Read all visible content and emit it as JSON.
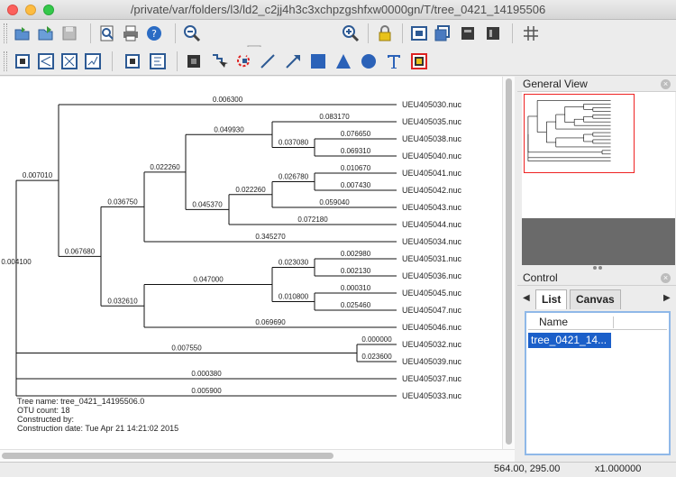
{
  "window": {
    "title": "/private/var/folders/l3/ld2_c2jj4h3c3xchpzgshfxw0000gn/T/tree_0421_14195506"
  },
  "toolbar": {
    "row1_icons": [
      "open-icon",
      "open-as-icon",
      "save-icon",
      "find-icon",
      "print-icon",
      "help-icon",
      "zoom-out-icon",
      "zoom-in-icon",
      "lock-icon",
      "fit-window-icon",
      "fit-page-icon",
      "layout-a-icon",
      "layout-b-icon",
      "grid-icon"
    ],
    "zoom_slider_value": 0.35,
    "row2_icons": [
      "rect-tree-icon",
      "slanted-tree-icon",
      "radial-tree-icon",
      "unrooted-tree-icon",
      "select-icon",
      "align-icon",
      "pointer-icon",
      "lasso-icon",
      "line-icon",
      "arrow-icon",
      "rectangle-icon",
      "triangle-icon",
      "ellipse-icon",
      "text-icon",
      "image-icon"
    ]
  },
  "tree": {
    "leaves": [
      "UEU405030.nuc",
      "UEU405035.nuc",
      "UEU405038.nuc",
      "UEU405040.nuc",
      "UEU405041.nuc",
      "UEU405042.nuc",
      "UEU405043.nuc",
      "UEU405044.nuc",
      "UEU405034.nuc",
      "UEU405031.nuc",
      "UEU405036.nuc",
      "UEU405045.nuc",
      "UEU405047.nuc",
      "UEU405046.nuc",
      "UEU405032.nuc",
      "UEU405039.nuc",
      "UEU405037.nuc",
      "UEU405033.nuc"
    ],
    "branch_lengths": {
      "b_0030": "0.006300",
      "b_0035": "0.083170",
      "b_0038": "0.076650",
      "b_0040": "0.069310",
      "b_c3840": "0.037080",
      "b_c353840": "0.049930",
      "b_0041": "0.010670",
      "b_0042": "0.007430",
      "b_c4142": "0.026780",
      "b_0043": "0.059040",
      "b_c414243": "0.022260",
      "b_0044": "0.072180",
      "b_c41to44": "0.045370",
      "b_c35to44": "0.022260",
      "b_0034": "0.345270",
      "b_c35to34": "0.036750",
      "b_0031": "0.002980",
      "b_0036": "0.002130",
      "b_c3136": "0.023030",
      "b_0045": "0.000310",
      "b_0047": "0.025460",
      "b_c4547": "0.010800",
      "b_c31to47": "0.047000",
      "b_0046": "0.069690",
      "b_c31to46": "0.032610",
      "b_bigclade": "0.067680",
      "b_c30big": "0.007010",
      "b_0032": "0.000000",
      "b_0039": "0.023600",
      "b_c3239": "0.007550",
      "b_root_inner": "0.004100",
      "b_0037": "0.000380",
      "b_0033": "0.005900"
    },
    "info": {
      "name_line": "Tree name: tree_0421_14195506.0",
      "otu_line": "OTU count: 18",
      "constructed_line": "Constructed by:",
      "date_line": "Construction date: Tue Apr 21 14:21:02 2015"
    }
  },
  "general_view": {
    "title": "General View"
  },
  "control": {
    "title": "Control",
    "tabs": [
      "List",
      "Canvas Rect"
    ],
    "active_tab": "List",
    "list_header": "Name",
    "list_items": [
      "tree_0421_14..."
    ]
  },
  "status": {
    "coords": "564.00, 295.00",
    "zoom": "x1.000000"
  }
}
